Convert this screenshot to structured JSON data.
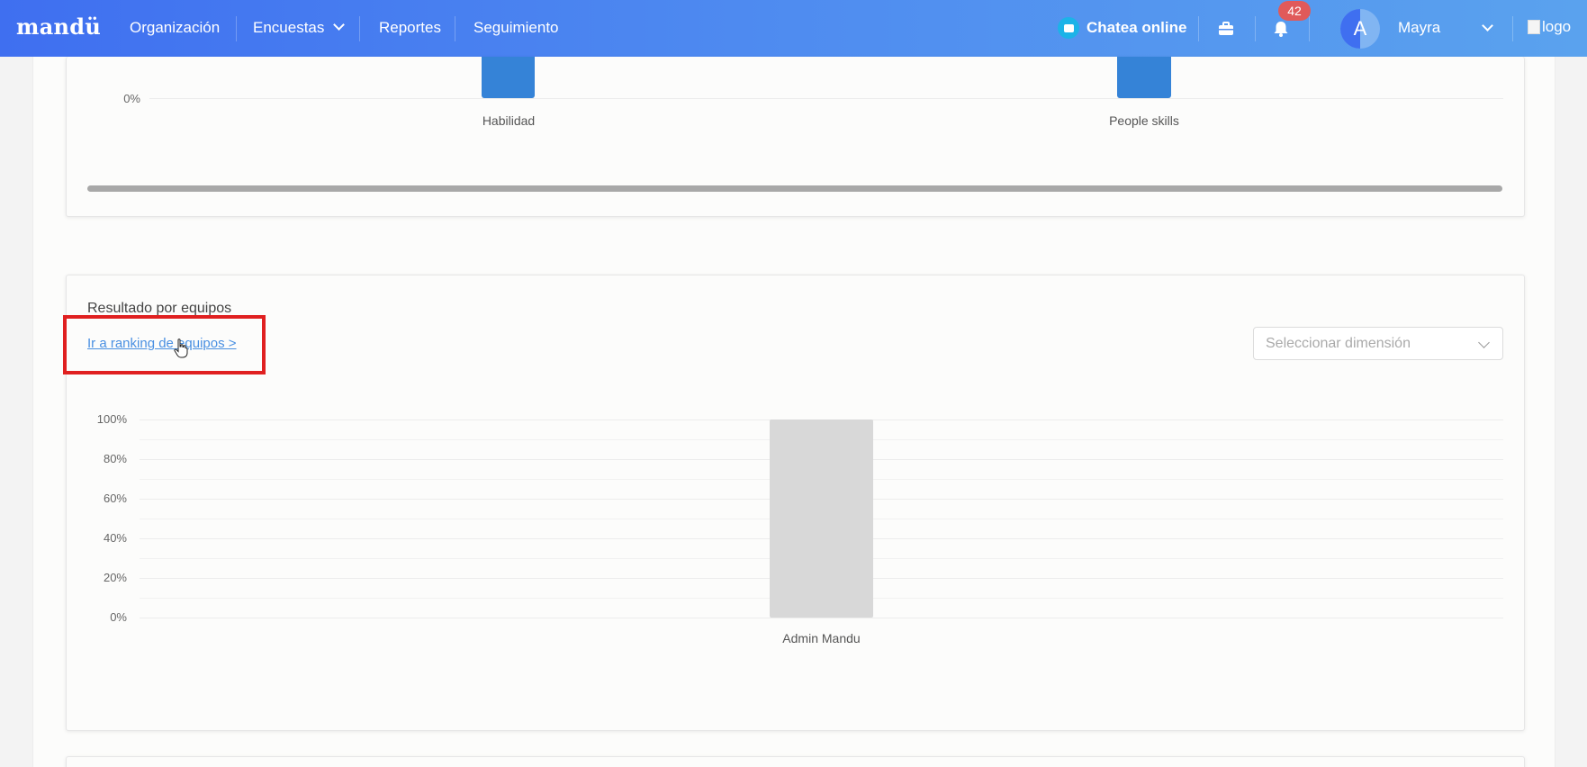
{
  "nav": {
    "brand": "mandü",
    "items": [
      "Organización",
      "Encuestas",
      "Reportes",
      "Seguimiento"
    ],
    "chat_label": "Chatea online",
    "notification_count": "42",
    "avatar_letter": "A",
    "user_name": "Mayra",
    "logo_alt": "logo",
    "colors": {
      "gradient_start": "#3f6ff0",
      "gradient_end": "#5aa2ee",
      "badge": "#e05a5a",
      "chat_icon": "#1cb3e8"
    }
  },
  "top_chart": {
    "y_tick": "0%",
    "categories": [
      "Habilidad",
      "People skills"
    ],
    "bar_color": "#3583d7"
  },
  "team_section": {
    "title": "Resultado por equipos",
    "ranking_link": "Ir a ranking de equipos >",
    "dimension_placeholder": "Seleccionar dimensión"
  },
  "chart_data": {
    "type": "bar",
    "title": "Resultado por equipos",
    "categories": [
      "Admin Mandu"
    ],
    "values": [
      100
    ],
    "yticks": [
      "100%",
      "80%",
      "60%",
      "40%",
      "20%",
      "0%"
    ],
    "ylim": [
      0,
      100
    ],
    "bar_color": "#d8d8d8",
    "grid": true
  }
}
